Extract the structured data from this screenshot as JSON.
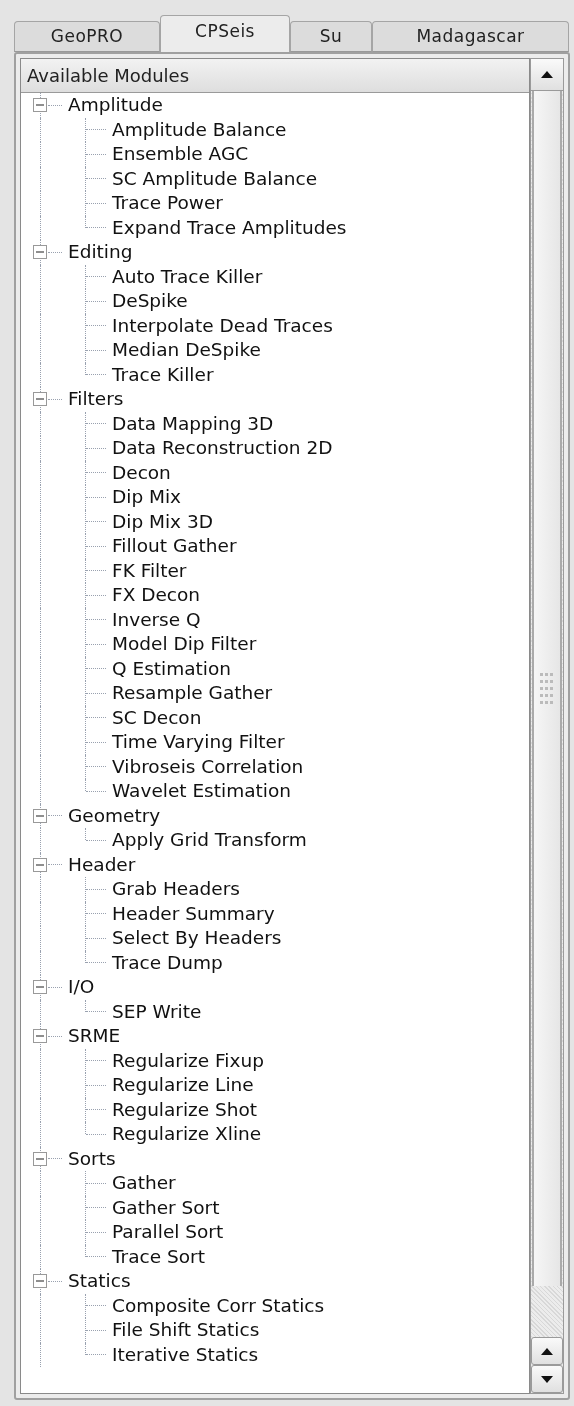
{
  "tabs": [
    {
      "label": "GeoPRO",
      "selected": false
    },
    {
      "label": "CPSeis",
      "selected": true
    },
    {
      "label": "Su",
      "selected": false
    },
    {
      "label": "Madagascar",
      "selected": false
    }
  ],
  "tree": {
    "header": "Available Modules",
    "categories": [
      {
        "label": "Amplitude",
        "expanded": true,
        "children": [
          "Amplitude Balance",
          "Ensemble AGC",
          "SC Amplitude Balance",
          "Trace Power",
          "Expand Trace Amplitudes"
        ]
      },
      {
        "label": "Editing",
        "expanded": true,
        "children": [
          "Auto Trace Killer",
          "DeSpike",
          "Interpolate Dead Traces",
          "Median DeSpike",
          "Trace Killer"
        ]
      },
      {
        "label": "Filters",
        "expanded": true,
        "children": [
          "Data Mapping 3D",
          "Data Reconstruction 2D",
          "Decon",
          "Dip Mix",
          "Dip Mix 3D",
          "Fillout Gather",
          "FK Filter",
          "FX Decon",
          "Inverse Q",
          "Model Dip Filter",
          "Q Estimation",
          "Resample Gather",
          "SC Decon",
          "Time Varying Filter",
          "Vibroseis Correlation",
          "Wavelet Estimation"
        ]
      },
      {
        "label": "Geometry",
        "expanded": true,
        "children": [
          "Apply Grid Transform"
        ]
      },
      {
        "label": "Header",
        "expanded": true,
        "children": [
          "Grab Headers",
          "Header Summary",
          "Select By Headers",
          "Trace Dump"
        ]
      },
      {
        "label": "I/O",
        "expanded": true,
        "children": [
          "SEP Write"
        ]
      },
      {
        "label": "SRME",
        "expanded": true,
        "children": [
          "Regularize Fixup",
          "Regularize Line",
          "Regularize Shot",
          "Regularize Xline"
        ]
      },
      {
        "label": "Sorts",
        "expanded": true,
        "children": [
          "Gather",
          "Gather Sort",
          "Parallel Sort",
          "Trace Sort"
        ]
      },
      {
        "label": "Statics",
        "expanded": true,
        "children": [
          "Composite Corr Statics",
          "File Shift Statics",
          "Iterative Statics"
        ]
      }
    ]
  }
}
